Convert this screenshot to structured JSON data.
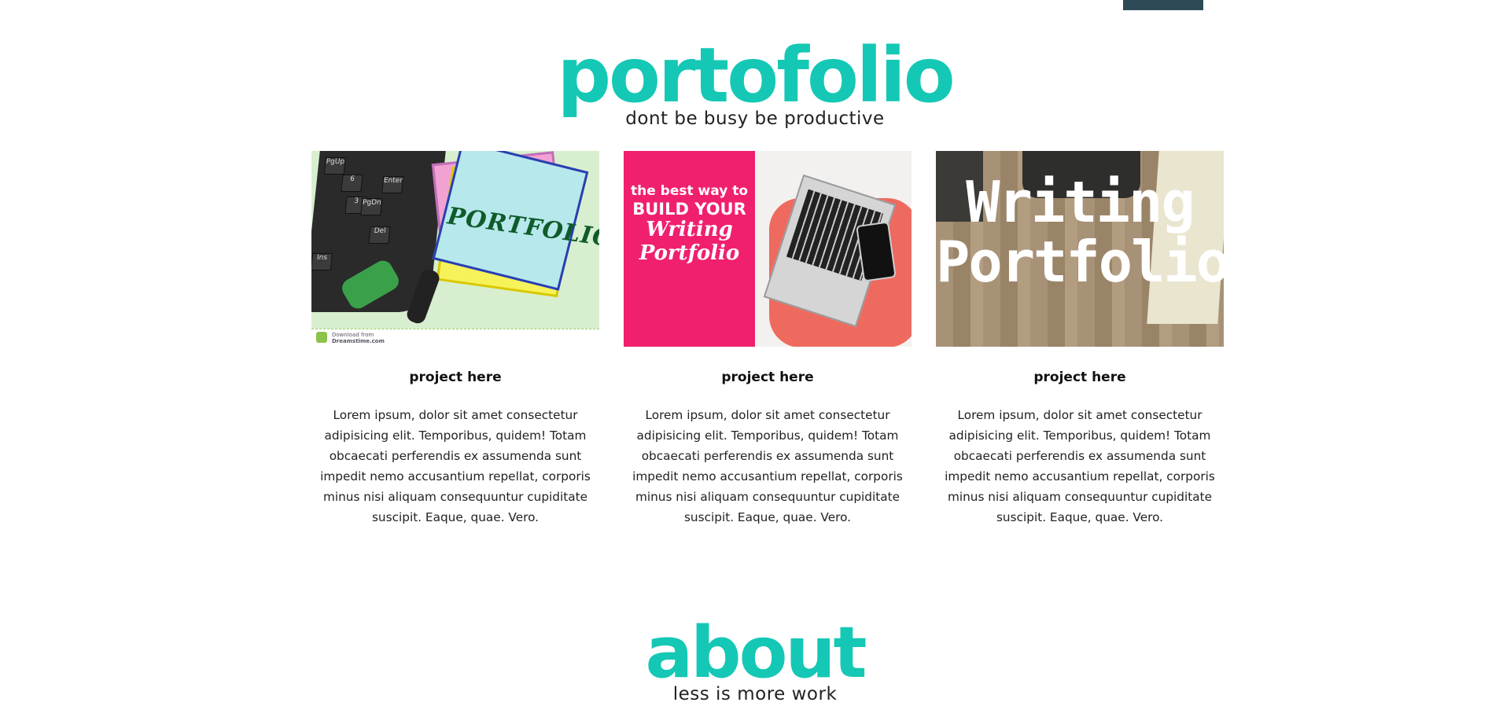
{
  "portfolio": {
    "title": "portofolio",
    "subtitle": "dont be busy be productive"
  },
  "projects": [
    {
      "title": "project here",
      "description": "Lorem ipsum, dolor sit amet consectetur adipisicing elit. Temporibus, quidem! Totam obcaecati perferendis ex assumenda sunt impedit nemo accusantium repellat, corporis minus nisi aliquam consequuntur cupiditate suscipit. Eaque, quae. Vero.",
      "image": {
        "note_text": "PORTFOLIO",
        "keys": [
          "PgUp",
          "6",
          "Enter",
          "3",
          "PgDn",
          "Del",
          "Ins"
        ],
        "footer_line1": "Download from",
        "footer_line2": "Dreamstime.com"
      }
    },
    {
      "title": "project here",
      "description": "Lorem ipsum, dolor sit amet consectetur adipisicing elit. Temporibus, quidem! Totam obcaecati perferendis ex assumenda sunt impedit nemo accusantium repellat, corporis minus nisi aliquam consequuntur cupiditate suscipit. Eaque, quae. Vero.",
      "image": {
        "line1": "the best way to",
        "line2": "BUILD YOUR",
        "line3": "Writing",
        "line4": "Portfolio"
      }
    },
    {
      "title": "project here",
      "description": "Lorem ipsum, dolor sit amet consectetur adipisicing elit. Temporibus, quidem! Totam obcaecati perferendis ex assumenda sunt impedit nemo accusantium repellat, corporis minus nisi aliquam consequuntur cupiditate suscipit. Eaque, quae. Vero.",
      "image": {
        "line1": "Writing",
        "line2": "Portfolio"
      }
    }
  ],
  "about": {
    "title": "about",
    "subtitle": "less is more work"
  },
  "colors": {
    "accent": "#14c8b5",
    "top_bar": "#2f4a57",
    "pink_panel": "#f0206f"
  }
}
